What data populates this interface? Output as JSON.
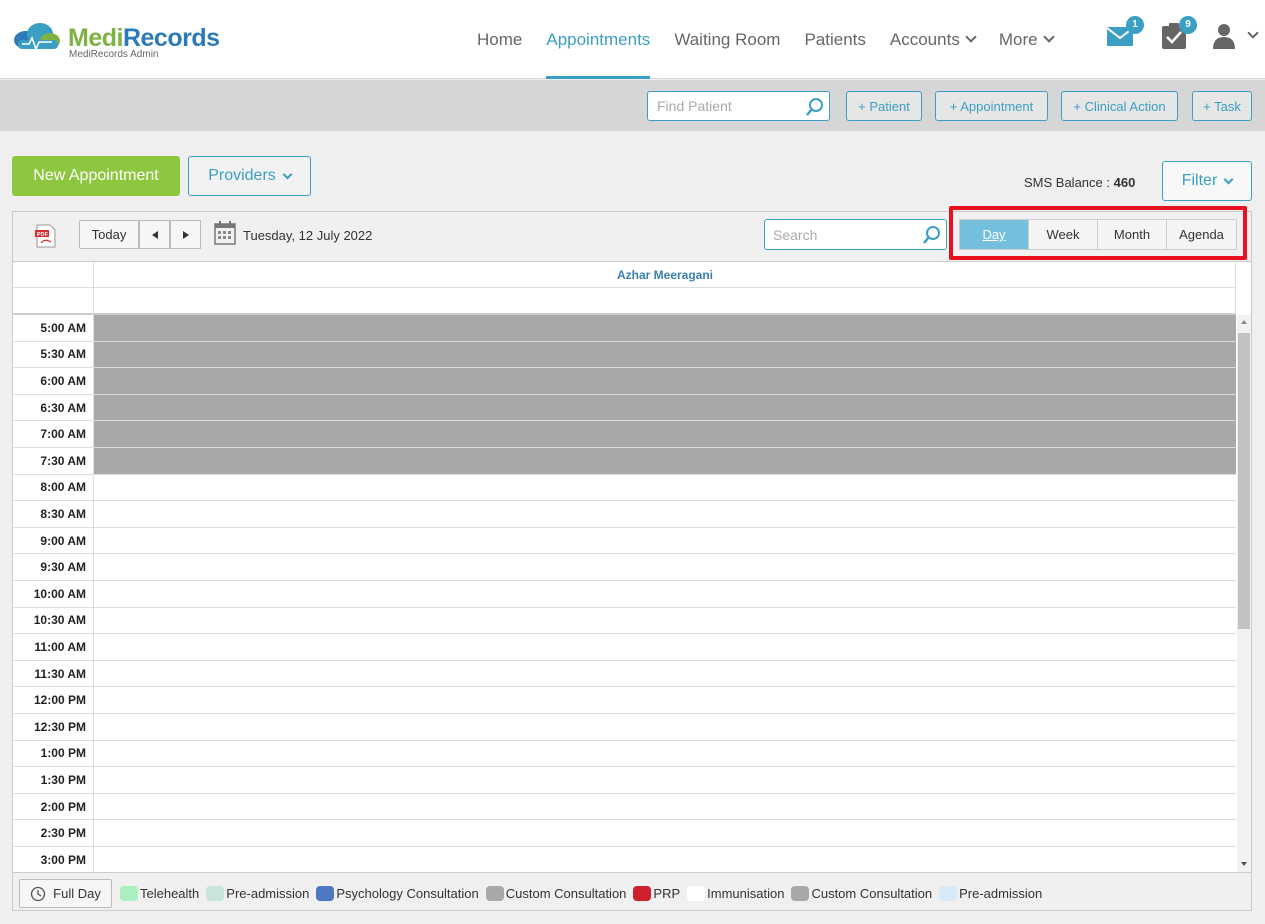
{
  "brand": {
    "name_part1": "Medi",
    "name_part2": "Records",
    "subtitle": "MediRecords Admin"
  },
  "nav": {
    "items": [
      {
        "label": "Home",
        "active": false,
        "dropdown": false
      },
      {
        "label": "Appointments",
        "active": true,
        "dropdown": false
      },
      {
        "label": "Waiting Room",
        "active": false,
        "dropdown": false
      },
      {
        "label": "Patients",
        "active": false,
        "dropdown": false
      },
      {
        "label": "Accounts",
        "active": false,
        "dropdown": true
      },
      {
        "label": "More",
        "active": false,
        "dropdown": true
      }
    ],
    "mail_badge": "1",
    "tasks_badge": "9"
  },
  "toolbar": {
    "find_patient_placeholder": "Find Patient",
    "add_patient": "+ Patient",
    "add_appointment": "+ Appointment",
    "add_clinical_action": "+ Clinical Action",
    "add_task": "+ Task"
  },
  "actions": {
    "new_appointment": "New Appointment",
    "providers": "Providers",
    "sms_label": "SMS Balance :",
    "sms_value": "460",
    "filter": "Filter"
  },
  "scheduler": {
    "today": "Today",
    "date": "Tuesday, 12 July 2022",
    "search_placeholder": "Search",
    "views": [
      "Day",
      "Week",
      "Month",
      "Agenda"
    ],
    "active_view": "Day",
    "provider": "Azhar Meeragani",
    "time_slots": [
      {
        "time": "5:00 AM",
        "blocked": true
      },
      {
        "time": "5:30 AM",
        "blocked": true
      },
      {
        "time": "6:00 AM",
        "blocked": true
      },
      {
        "time": "6:30 AM",
        "blocked": true
      },
      {
        "time": "7:00 AM",
        "blocked": true
      },
      {
        "time": "7:30 AM",
        "blocked": true
      },
      {
        "time": "8:00 AM",
        "blocked": false
      },
      {
        "time": "8:30 AM",
        "blocked": false
      },
      {
        "time": "9:00 AM",
        "blocked": false
      },
      {
        "time": "9:30 AM",
        "blocked": false
      },
      {
        "time": "10:00 AM",
        "blocked": false
      },
      {
        "time": "10:30 AM",
        "blocked": false
      },
      {
        "time": "11:00 AM",
        "blocked": false
      },
      {
        "time": "11:30 AM",
        "blocked": false
      },
      {
        "time": "12:00 PM",
        "blocked": false
      },
      {
        "time": "12:30 PM",
        "blocked": false
      },
      {
        "time": "1:00 PM",
        "blocked": false
      },
      {
        "time": "1:30 PM",
        "blocked": false
      },
      {
        "time": "2:00 PM",
        "blocked": false
      },
      {
        "time": "2:30 PM",
        "blocked": false
      },
      {
        "time": "3:00 PM",
        "blocked": false
      }
    ],
    "full_day": "Full Day",
    "legend": [
      {
        "label": "Telehealth",
        "color": "#a8f0c0"
      },
      {
        "label": "Pre-admission",
        "color": "#c8e4dc"
      },
      {
        "label": "Psychology Consultation",
        "color": "#4f78c4"
      },
      {
        "label": "Custom Consultation",
        "color": "#a8a8a8"
      },
      {
        "label": "PRP",
        "color": "#d0202e"
      },
      {
        "label": "Immunisation",
        "color": "#ffffff"
      },
      {
        "label": "Custom Consultation",
        "color": "#a8a8a8"
      },
      {
        "label": "Pre-admission",
        "color": "#d8eaf8"
      }
    ]
  },
  "colors": {
    "accent": "#3b9fc4",
    "brand_green": "#8dc63f",
    "highlight": "#e8101f"
  }
}
